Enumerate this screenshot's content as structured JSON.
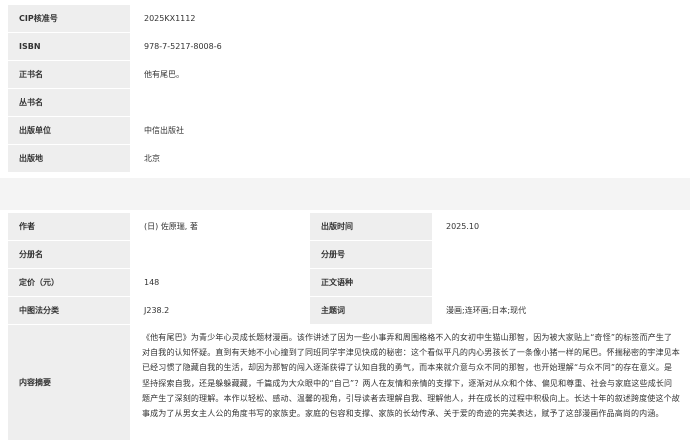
{
  "basic_info": [
    {
      "label": "CIP核准号",
      "value": "2025KX1112"
    },
    {
      "label": "ISBN",
      "value": "978-7-5217-8008-6"
    },
    {
      "label": "正书名",
      "value": "他有尾巴。"
    },
    {
      "label": "丛书名",
      "value": ""
    },
    {
      "label": "出版单位",
      "value": "中信出版社"
    },
    {
      "label": "出版地",
      "value": "北京"
    }
  ],
  "detail_info": [
    {
      "left_label": "作者",
      "left_value": "(日) 佐原瑞, 著",
      "right_label": "出版时间",
      "right_value": "2025.10"
    },
    {
      "left_label": "分册名",
      "left_value": "",
      "right_label": "分册号",
      "right_value": ""
    },
    {
      "left_label": "定价（元）",
      "left_value": "148",
      "right_label": "正文语种",
      "right_value": ""
    },
    {
      "left_label": "中图法分类",
      "left_value": "J238.2",
      "right_label": "主题词",
      "right_value": "漫画;连环画;日本;现代"
    }
  ],
  "summary": {
    "label": "内容摘要",
    "text": "《他有尾巴》为青少年心灵成长题材漫画。该作讲述了因为一些小事弄和周围格格不入的女初中生猫山那智，因为被大家贴上“奇怪”的标签而产生了对自我的认知怀疑。直到有天她不小心撞到了同班同学宇津见快成的秘密：这个看似平凡的内心男孩长了一条像小猪一样的尾巴。怀揣秘密的宇津见本已经习惯了隐藏自我的生活，却因为那智的闯入逐渐获得了认知自我的勇气，而本来就介意与众不同的那智，也开始理解“与众不同”的存在意义。是坚持探索自我，还是躲躲藏藏，千篇成为大众眼中的“自己”？两人在友情和亲情的支撑下，逐渐对从众和个体、偏见和尊重、社会与家庭这些成长问题产生了深刻的理解。本作以轻松、感动、温馨的视角，引导读者去理解自我、理解他人，并在成长的过程中积极向上。长达十年的叙述跨度使这个故事成为了从男女主人公的角度书写的家族史。家庭的包容和支撑、家族的长幼传承、关于爱的奇迹的完美表达，赋予了这部漫画作品高尚的内涵。"
  }
}
